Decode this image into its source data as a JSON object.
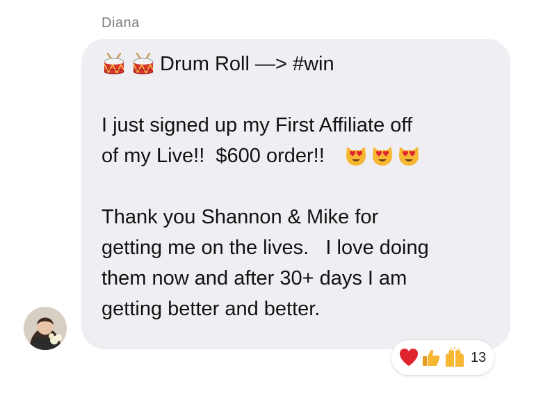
{
  "message": {
    "sender": "Diana",
    "lines": {
      "l1": "Drum Roll —> #win",
      "l2": "I just signed up my First Affiliate off",
      "l3": "of my Live!!  $600 order!!",
      "l4": "Thank you Shannon & Mike for",
      "l5": "getting me on the lives.   I love doing",
      "l6": "them now and after 30+ days I am",
      "l7": "getting better and better."
    },
    "emoji": {
      "leading": [
        "drum-icon",
        "drum-icon"
      ],
      "trailing": [
        "heart-eyes-cat-icon",
        "heart-eyes-cat-icon",
        "heart-eyes-cat-icon"
      ]
    }
  },
  "reactions": {
    "icons": [
      "heart-icon",
      "thumbs-up-icon",
      "raised-hands-icon"
    ],
    "count": "13"
  },
  "colors": {
    "bubble": "#efeff3",
    "text": "#111111",
    "sender": "#7a7d83",
    "heart": "#e0242f",
    "emoji_yellow": "#f7b733"
  }
}
